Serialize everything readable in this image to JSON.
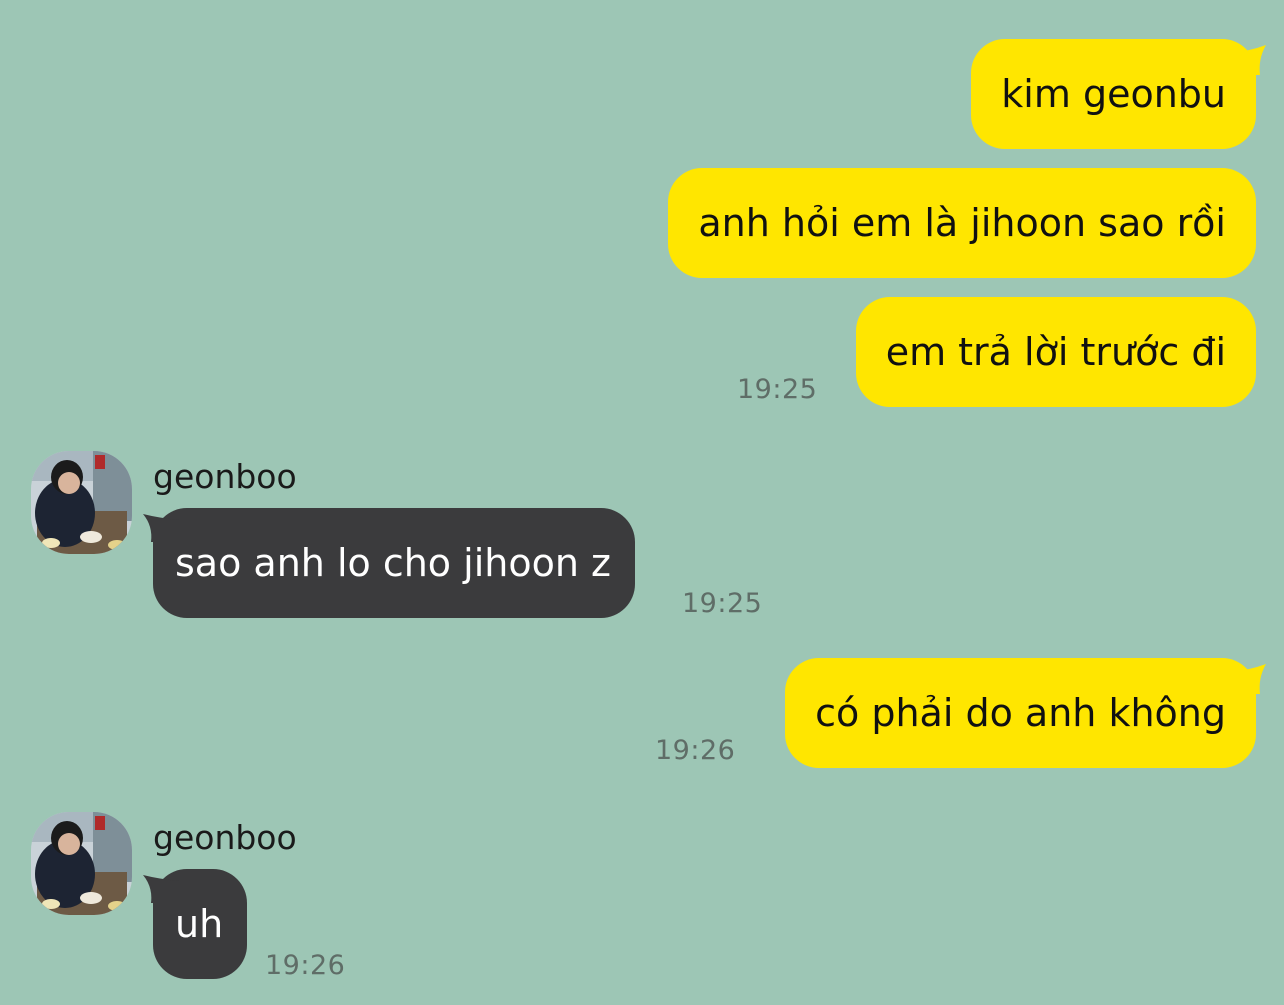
{
  "colors": {
    "background": "#9dc6b5",
    "outgoing_bubble": "#ffe600",
    "incoming_bubble": "#3b3b3d",
    "timestamp": "#5f6d67"
  },
  "messages": [
    {
      "direction": "outgoing",
      "text": "kim geonbu"
    },
    {
      "direction": "outgoing",
      "text": "anh hỏi em là jihoon sao rồi"
    },
    {
      "direction": "outgoing",
      "text": "em trả lời trước đi",
      "time": "19:25"
    },
    {
      "direction": "incoming",
      "sender": "geonboo",
      "avatar": "profile-photo",
      "text": "sao anh lo cho jihoon z",
      "time": "19:25"
    },
    {
      "direction": "outgoing",
      "text": "có phải do anh không",
      "time": "19:26"
    },
    {
      "direction": "incoming",
      "sender": "geonboo",
      "avatar": "profile-photo",
      "text": "uh",
      "time": "19:26"
    }
  ]
}
